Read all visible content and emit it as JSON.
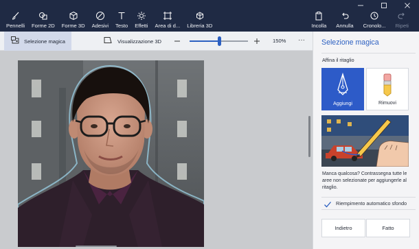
{
  "window": {
    "controls": [
      "minimize-icon",
      "maximize-icon",
      "close-icon"
    ]
  },
  "ribbon": {
    "tools": [
      {
        "label": "Pennelli",
        "icon": "brush-icon"
      },
      {
        "label": "Forme 2D",
        "icon": "shapes-2d-icon"
      },
      {
        "label": "Forme 3D",
        "icon": "cube-icon"
      },
      {
        "label": "Adesivi",
        "icon": "sticker-icon"
      },
      {
        "label": "Testo",
        "icon": "text-icon"
      },
      {
        "label": "Effetti",
        "icon": "sun-icon"
      },
      {
        "label": "Area di d...",
        "icon": "canvas-crop-icon"
      },
      {
        "label": "Libreria 3D",
        "icon": "library-3d-icon"
      }
    ],
    "right_tools": [
      {
        "label": "Incolla",
        "icon": "paste-icon"
      },
      {
        "label": "Annulla",
        "icon": "undo-icon"
      },
      {
        "label": "Cronolo...",
        "icon": "history-icon"
      },
      {
        "label": "Ripeti",
        "icon": "redo-icon"
      }
    ]
  },
  "toolbar": {
    "magic_select_label": "Selezione magica",
    "view3d_label": "Visualizzazione 3D",
    "zoom_value": "150%",
    "zoom_level": 0.5,
    "more_label": "···"
  },
  "panel": {
    "title": "Selezione magica",
    "subtitle": "Affina il ritaglio",
    "add_label": "Aggiungi",
    "remove_label": "Rimuovi",
    "hint": "Manca qualcosa? Contrassegna tutte le aree non selezionate per aggiungerle al ritaglio.",
    "auto_fill_label": "Riempimento automatico sfondo",
    "auto_fill_checked": true,
    "back_label": "Indietro",
    "done_label": "Fatto"
  },
  "colors": {
    "ribbon_bg": "#1f2a44",
    "accent": "#2b5fc1",
    "add_button": "#2d5bc8",
    "panel_bg": "#f4f4f6"
  }
}
